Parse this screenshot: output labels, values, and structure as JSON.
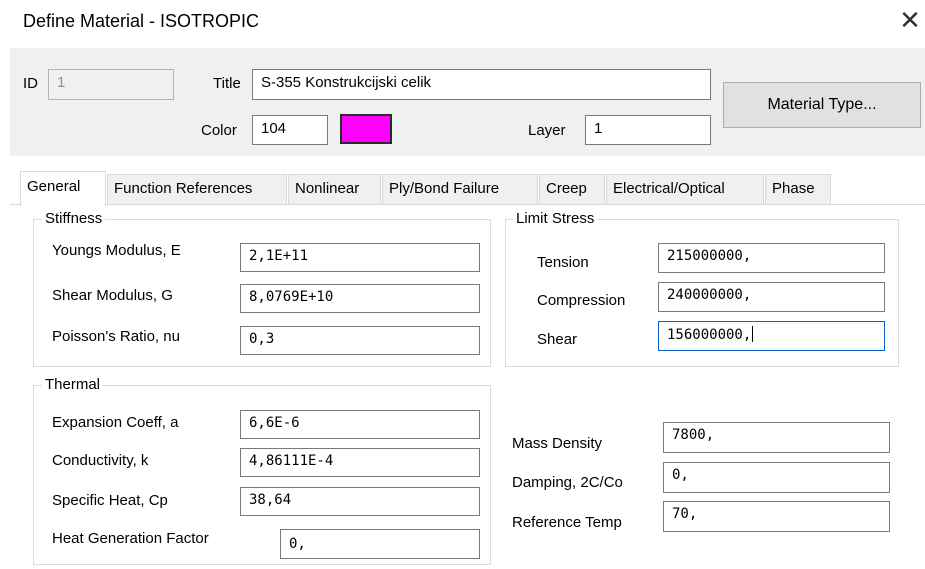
{
  "window": {
    "title": "Define Material - ISOTROPIC",
    "close_glyph": "✕"
  },
  "header": {
    "id_label": "ID",
    "id_value": "1",
    "title_label": "Title",
    "title_value": "S-355 Konstrukcijski celik",
    "color_label": "Color",
    "color_value": "104",
    "color_swatch": "#ff00ff",
    "layer_label": "Layer",
    "layer_value": "1",
    "material_type_button": "Material Type..."
  },
  "tabs": [
    {
      "label": "General",
      "active": true
    },
    {
      "label": "Function References"
    },
    {
      "label": "Nonlinear"
    },
    {
      "label": "Ply/Bond Failure"
    },
    {
      "label": "Creep"
    },
    {
      "label": "Electrical/Optical"
    },
    {
      "label": "Phase"
    }
  ],
  "stiffness": {
    "title": "Stiffness",
    "youngs_label": "Youngs Modulus, E",
    "youngs_value": "2,1E+11",
    "shear_label": "Shear Modulus, G",
    "shear_value": "8,0769E+10",
    "poisson_label": "Poisson's Ratio, nu",
    "poisson_value": "0,3"
  },
  "limit_stress": {
    "title": "Limit Stress",
    "tension_label": "Tension",
    "tension_value": "215000000,",
    "compression_label": "Compression",
    "compression_value": "240000000,",
    "shear_label": "Shear",
    "shear_value": "156000000,"
  },
  "thermal": {
    "title": "Thermal",
    "expansion_label": "Expansion Coeff, a",
    "expansion_value": "6,6E-6",
    "conductivity_label": "Conductivity, k",
    "conductivity_value": "4,86111E-4",
    "specific_heat_label": "Specific Heat, Cp",
    "specific_heat_value": "38,64",
    "heat_gen_label": "Heat Generation Factor",
    "heat_gen_value": "0,"
  },
  "misc": {
    "mass_density_label": "Mass Density",
    "mass_density_value": "7800,",
    "damping_label": "Damping, 2C/Co",
    "damping_value": "0,",
    "ref_temp_label": "Reference Temp",
    "ref_temp_value": "70,"
  }
}
